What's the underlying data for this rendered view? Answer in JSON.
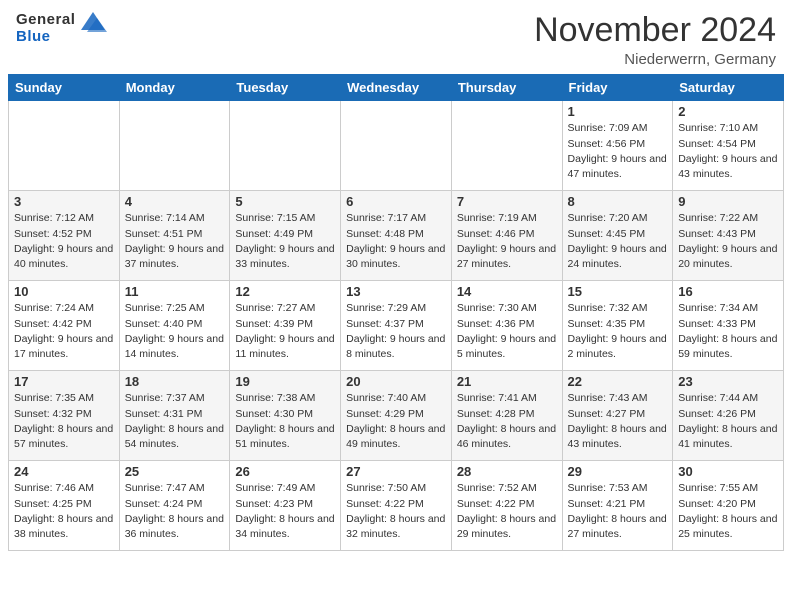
{
  "header": {
    "logo_general": "General",
    "logo_blue": "Blue",
    "month_year": "November 2024",
    "location": "Niederwerrn, Germany"
  },
  "calendar": {
    "days_of_week": [
      "Sunday",
      "Monday",
      "Tuesday",
      "Wednesday",
      "Thursday",
      "Friday",
      "Saturday"
    ],
    "weeks": [
      [
        {
          "day": "",
          "sunrise": "",
          "sunset": "",
          "daylight": "",
          "empty": true
        },
        {
          "day": "",
          "sunrise": "",
          "sunset": "",
          "daylight": "",
          "empty": true
        },
        {
          "day": "",
          "sunrise": "",
          "sunset": "",
          "daylight": "",
          "empty": true
        },
        {
          "day": "",
          "sunrise": "",
          "sunset": "",
          "daylight": "",
          "empty": true
        },
        {
          "day": "",
          "sunrise": "",
          "sunset": "",
          "daylight": "",
          "empty": true
        },
        {
          "day": "1",
          "sunrise": "Sunrise: 7:09 AM",
          "sunset": "Sunset: 4:56 PM",
          "daylight": "Daylight: 9 hours and 47 minutes."
        },
        {
          "day": "2",
          "sunrise": "Sunrise: 7:10 AM",
          "sunset": "Sunset: 4:54 PM",
          "daylight": "Daylight: 9 hours and 43 minutes."
        }
      ],
      [
        {
          "day": "3",
          "sunrise": "Sunrise: 7:12 AM",
          "sunset": "Sunset: 4:52 PM",
          "daylight": "Daylight: 9 hours and 40 minutes."
        },
        {
          "day": "4",
          "sunrise": "Sunrise: 7:14 AM",
          "sunset": "Sunset: 4:51 PM",
          "daylight": "Daylight: 9 hours and 37 minutes."
        },
        {
          "day": "5",
          "sunrise": "Sunrise: 7:15 AM",
          "sunset": "Sunset: 4:49 PM",
          "daylight": "Daylight: 9 hours and 33 minutes."
        },
        {
          "day": "6",
          "sunrise": "Sunrise: 7:17 AM",
          "sunset": "Sunset: 4:48 PM",
          "daylight": "Daylight: 9 hours and 30 minutes."
        },
        {
          "day": "7",
          "sunrise": "Sunrise: 7:19 AM",
          "sunset": "Sunset: 4:46 PM",
          "daylight": "Daylight: 9 hours and 27 minutes."
        },
        {
          "day": "8",
          "sunrise": "Sunrise: 7:20 AM",
          "sunset": "Sunset: 4:45 PM",
          "daylight": "Daylight: 9 hours and 24 minutes."
        },
        {
          "day": "9",
          "sunrise": "Sunrise: 7:22 AM",
          "sunset": "Sunset: 4:43 PM",
          "daylight": "Daylight: 9 hours and 20 minutes."
        }
      ],
      [
        {
          "day": "10",
          "sunrise": "Sunrise: 7:24 AM",
          "sunset": "Sunset: 4:42 PM",
          "daylight": "Daylight: 9 hours and 17 minutes."
        },
        {
          "day": "11",
          "sunrise": "Sunrise: 7:25 AM",
          "sunset": "Sunset: 4:40 PM",
          "daylight": "Daylight: 9 hours and 14 minutes."
        },
        {
          "day": "12",
          "sunrise": "Sunrise: 7:27 AM",
          "sunset": "Sunset: 4:39 PM",
          "daylight": "Daylight: 9 hours and 11 minutes."
        },
        {
          "day": "13",
          "sunrise": "Sunrise: 7:29 AM",
          "sunset": "Sunset: 4:37 PM",
          "daylight": "Daylight: 9 hours and 8 minutes."
        },
        {
          "day": "14",
          "sunrise": "Sunrise: 7:30 AM",
          "sunset": "Sunset: 4:36 PM",
          "daylight": "Daylight: 9 hours and 5 minutes."
        },
        {
          "day": "15",
          "sunrise": "Sunrise: 7:32 AM",
          "sunset": "Sunset: 4:35 PM",
          "daylight": "Daylight: 9 hours and 2 minutes."
        },
        {
          "day": "16",
          "sunrise": "Sunrise: 7:34 AM",
          "sunset": "Sunset: 4:33 PM",
          "daylight": "Daylight: 8 hours and 59 minutes."
        }
      ],
      [
        {
          "day": "17",
          "sunrise": "Sunrise: 7:35 AM",
          "sunset": "Sunset: 4:32 PM",
          "daylight": "Daylight: 8 hours and 57 minutes."
        },
        {
          "day": "18",
          "sunrise": "Sunrise: 7:37 AM",
          "sunset": "Sunset: 4:31 PM",
          "daylight": "Daylight: 8 hours and 54 minutes."
        },
        {
          "day": "19",
          "sunrise": "Sunrise: 7:38 AM",
          "sunset": "Sunset: 4:30 PM",
          "daylight": "Daylight: 8 hours and 51 minutes."
        },
        {
          "day": "20",
          "sunrise": "Sunrise: 7:40 AM",
          "sunset": "Sunset: 4:29 PM",
          "daylight": "Daylight: 8 hours and 49 minutes."
        },
        {
          "day": "21",
          "sunrise": "Sunrise: 7:41 AM",
          "sunset": "Sunset: 4:28 PM",
          "daylight": "Daylight: 8 hours and 46 minutes."
        },
        {
          "day": "22",
          "sunrise": "Sunrise: 7:43 AM",
          "sunset": "Sunset: 4:27 PM",
          "daylight": "Daylight: 8 hours and 43 minutes."
        },
        {
          "day": "23",
          "sunrise": "Sunrise: 7:44 AM",
          "sunset": "Sunset: 4:26 PM",
          "daylight": "Daylight: 8 hours and 41 minutes."
        }
      ],
      [
        {
          "day": "24",
          "sunrise": "Sunrise: 7:46 AM",
          "sunset": "Sunset: 4:25 PM",
          "daylight": "Daylight: 8 hours and 38 minutes."
        },
        {
          "day": "25",
          "sunrise": "Sunrise: 7:47 AM",
          "sunset": "Sunset: 4:24 PM",
          "daylight": "Daylight: 8 hours and 36 minutes."
        },
        {
          "day": "26",
          "sunrise": "Sunrise: 7:49 AM",
          "sunset": "Sunset: 4:23 PM",
          "daylight": "Daylight: 8 hours and 34 minutes."
        },
        {
          "day": "27",
          "sunrise": "Sunrise: 7:50 AM",
          "sunset": "Sunset: 4:22 PM",
          "daylight": "Daylight: 8 hours and 32 minutes."
        },
        {
          "day": "28",
          "sunrise": "Sunrise: 7:52 AM",
          "sunset": "Sunset: 4:22 PM",
          "daylight": "Daylight: 8 hours and 29 minutes."
        },
        {
          "day": "29",
          "sunrise": "Sunrise: 7:53 AM",
          "sunset": "Sunset: 4:21 PM",
          "daylight": "Daylight: 8 hours and 27 minutes."
        },
        {
          "day": "30",
          "sunrise": "Sunrise: 7:55 AM",
          "sunset": "Sunset: 4:20 PM",
          "daylight": "Daylight: 8 hours and 25 minutes."
        }
      ]
    ]
  }
}
